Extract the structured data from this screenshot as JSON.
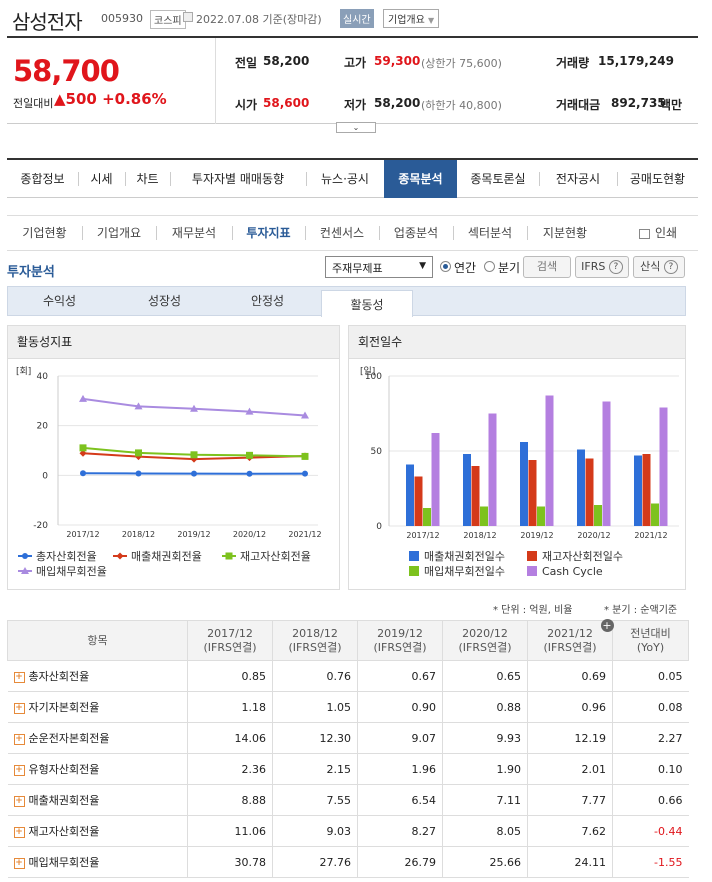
{
  "header": {
    "company": "삼성전자",
    "code": "005930",
    "market": "코스피",
    "date": "2022.07.08 기준(장마감)",
    "realtime": "실시간",
    "overview": "기업개요"
  },
  "quote": {
    "price": "58,700",
    "change_label": "전일대비",
    "change_abs": "500",
    "change_pct": "+0.86%",
    "prev_label": "전일",
    "prev": "58,200",
    "high_label": "고가",
    "high": "59,300",
    "upper_limit": "(상한가 75,600)",
    "volume_label": "거래량",
    "volume": "15,179,249",
    "open_label": "시가",
    "open": "58,600",
    "low_label": "저가",
    "low": "58,200",
    "lower_limit": "(하한가 40,800)",
    "amount_label": "거래대금",
    "amount": "892,735",
    "amount_unit": "백만"
  },
  "nav_main": [
    "종합정보",
    "시세",
    "차트",
    "투자자별 매매동향",
    "뉴스·공시",
    "종목분석",
    "종목토론실",
    "전자공시",
    "공매도현황"
  ],
  "nav_sub": [
    "기업현황",
    "기업개요",
    "재무분석",
    "투자지표",
    "컨센서스",
    "업종분석",
    "섹터분석",
    "지분현황"
  ],
  "print_label": "인쇄",
  "section_title": "투자분석",
  "filter": {
    "select": "주재무제표",
    "annual": "연간",
    "quarter": "분기",
    "search": "검색",
    "ifrs": "IFRS",
    "formula": "산식"
  },
  "sub_tabs": [
    "수익성",
    "성장성",
    "안정성",
    "활동성"
  ],
  "chart_data": [
    {
      "type": "line",
      "title": "활동성지표",
      "unit": "[회]",
      "categories": [
        "2017/12",
        "2018/12",
        "2019/12",
        "2020/12",
        "2021/12"
      ],
      "ylim": [
        -20,
        40
      ],
      "yticks": [
        40,
        20,
        0,
        -20
      ],
      "series": [
        {
          "name": "총자산회전율",
          "color": "#2e6fd8",
          "values": [
            0.85,
            0.76,
            0.67,
            0.65,
            0.69
          ]
        },
        {
          "name": "매출채권회전율",
          "color": "#d43a1a",
          "values": [
            8.88,
            7.55,
            6.54,
            7.11,
            7.77
          ]
        },
        {
          "name": "재고자산회전율",
          "color": "#7dc21e",
          "values": [
            11.06,
            9.03,
            8.27,
            8.05,
            7.62
          ]
        },
        {
          "name": "매입채무회전율",
          "color": "#a98be0",
          "values": [
            30.78,
            27.76,
            26.79,
            25.66,
            24.11
          ]
        }
      ]
    },
    {
      "type": "bar",
      "title": "회전일수",
      "unit": "[일]",
      "categories": [
        "2017/12",
        "2018/12",
        "2019/12",
        "2020/12",
        "2021/12"
      ],
      "ylim": [
        0,
        100
      ],
      "yticks": [
        100,
        50,
        0
      ],
      "series": [
        {
          "name": "매출채권회전일수",
          "color": "#2e6fd8",
          "values": [
            41,
            48,
            56,
            51,
            47
          ]
        },
        {
          "name": "재고자산회전일수",
          "color": "#d43a1a",
          "values": [
            33,
            40,
            44,
            45,
            48
          ]
        },
        {
          "name": "매입채무회전일수",
          "color": "#7dc21e",
          "values": [
            12,
            13,
            13,
            14,
            15
          ]
        },
        {
          "name": "Cash Cycle",
          "color": "#b47fe0",
          "values": [
            62,
            75,
            87,
            83,
            79
          ]
        }
      ]
    }
  ],
  "notes": {
    "unit": "* 단위 : 억원, 비율",
    "quarter": "* 분기 : 순액기준"
  },
  "table": {
    "headers": [
      "항목",
      "2017/12\n(IFRS연결)",
      "2018/12\n(IFRS연결)",
      "2019/12\n(IFRS연결)",
      "2020/12\n(IFRS연결)",
      "2021/12\n(IFRS연결)",
      "전년대비\n(YoY)"
    ],
    "rows": [
      [
        "총자산회전율",
        "0.85",
        "0.76",
        "0.67",
        "0.65",
        "0.69",
        "0.05"
      ],
      [
        "자기자본회전율",
        "1.18",
        "1.05",
        "0.90",
        "0.88",
        "0.96",
        "0.08"
      ],
      [
        "순운전자본회전율",
        "14.06",
        "12.30",
        "9.07",
        "9.93",
        "12.19",
        "2.27"
      ],
      [
        "유형자산회전율",
        "2.36",
        "2.15",
        "1.96",
        "1.90",
        "2.01",
        "0.10"
      ],
      [
        "매출채권회전율",
        "8.88",
        "7.55",
        "6.54",
        "7.11",
        "7.77",
        "0.66"
      ],
      [
        "재고자산회전율",
        "11.06",
        "9.03",
        "8.27",
        "8.05",
        "7.62",
        "-0.44"
      ],
      [
        "매입채무회전율",
        "30.78",
        "27.76",
        "26.79",
        "25.66",
        "24.11",
        "-1.55"
      ]
    ]
  }
}
